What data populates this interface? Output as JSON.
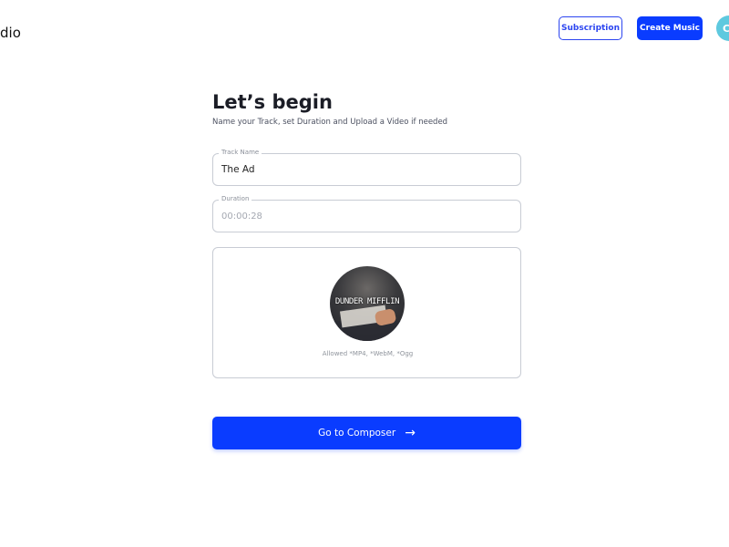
{
  "header": {
    "brand_text": "dio",
    "subscription_label": "Subscription",
    "create_music_label": "Create Music",
    "avatar_initial": "C"
  },
  "main": {
    "title": "Let’s begin",
    "subtitle": "Name your Track, set Duration and Upload a Video if needed",
    "track_name": {
      "label": "Track Name",
      "value": "The Ad"
    },
    "duration": {
      "label": "Duration",
      "placeholder": "00:00:28"
    },
    "upload": {
      "thumbnail_text": "DUNDER MIFFLIN",
      "allowed_formats": "Allowed *MP4, *WebM, *Ogg"
    },
    "composer_button_label": "Go to Composer",
    "composer_button_icon": "arrow-right-icon"
  },
  "colors": {
    "accent": "#0a3cff",
    "avatar": "#5ec9df"
  }
}
